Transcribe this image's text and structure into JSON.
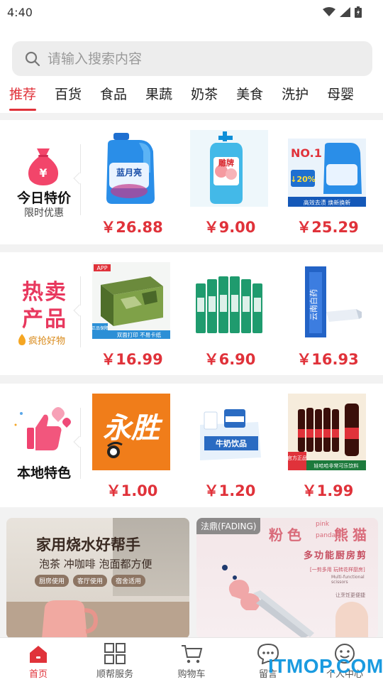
{
  "status": {
    "time": "4:40"
  },
  "search": {
    "placeholder": "请输入搜索内容"
  },
  "tabs": [
    {
      "label": "推荐",
      "active": true
    },
    {
      "label": "百货"
    },
    {
      "label": "食品"
    },
    {
      "label": "果蔬"
    },
    {
      "label": "奶茶"
    },
    {
      "label": "美食"
    },
    {
      "label": "洗护"
    },
    {
      "label": "母婴"
    }
  ],
  "sections": [
    {
      "title": "今日特价",
      "subtitle": "限时优惠",
      "products": [
        {
          "price": "￥26.88",
          "image": "laundry-detergent"
        },
        {
          "price": "￥9.00",
          "image": "dish-soap"
        },
        {
          "price": "￥25.29",
          "image": "detergent-ad",
          "image_text": {
            "rank": "NO.1",
            "discount": "↓20%",
            "footer": "高效去渍 焕新换新"
          }
        }
      ]
    },
    {
      "title": "热卖产品",
      "subtitle": "疯抢好物",
      "products": [
        {
          "price": "￥16.99",
          "image": "copy-paper",
          "image_text": {
            "tag": "APP",
            "footer": "双面打印 不易卡纸",
            "badge": "正品保障"
          }
        },
        {
          "price": "￥6.90",
          "image": "toothpaste-pack"
        },
        {
          "price": "￥16.93",
          "image": "toothpaste"
        }
      ]
    },
    {
      "title": "本地特色",
      "subtitle": "",
      "products": [
        {
          "price": "￥1.00",
          "image": "yongsheng-logo",
          "image_text": {
            "logo": "永胜"
          }
        },
        {
          "price": "￥1.20",
          "image": "milk-drink",
          "image_text": {
            "label": "牛奶饮品"
          }
        },
        {
          "price": "￥1.99",
          "image": "cola-bottles",
          "image_text": {
            "badge": "官方正品",
            "footer": "娃哈哈非常可乐饮料"
          }
        }
      ]
    }
  ],
  "banners": {
    "left": {
      "title": "家用烧水好帮手",
      "subtitle": "泡茶 冲咖啡 泡面都方便",
      "chips": [
        "厨房使用",
        "客厅使用",
        "宿舍适用"
      ]
    },
    "right": {
      "brand": "法鼎(FADING)",
      "title_a": "粉色",
      "title_b": "熊猫",
      "small_top": "pink",
      "small_bottom": "panda",
      "subtitle": "多功能厨房剪",
      "note": "[一剪多用 玩转花样厨房]",
      "note2": "Multi-functional scissors",
      "note3": "让烹饪更便捷"
    }
  },
  "bottom_nav": [
    {
      "label": "首页",
      "icon": "home-icon",
      "active": true
    },
    {
      "label": "顺帮服务",
      "icon": "grid-icon"
    },
    {
      "label": "购物车",
      "icon": "cart-icon"
    },
    {
      "label": "留言",
      "icon": "message-icon"
    },
    {
      "label": "个人中心",
      "icon": "smiley-icon"
    }
  ],
  "watermark": "ITMOP.COM",
  "colors": {
    "accent": "#e0323a",
    "watermark": "#1a9be0"
  }
}
